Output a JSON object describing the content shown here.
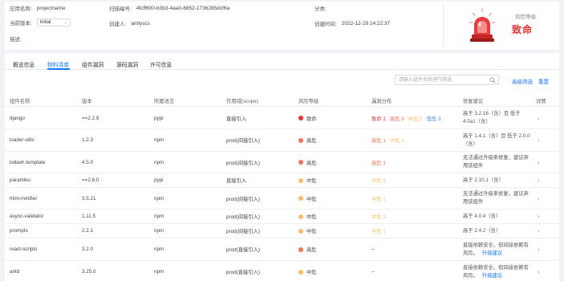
{
  "project": {
    "app_name_label": "应用名称:",
    "app_name": "projectname",
    "version_label": "当前版本:",
    "version": "initial",
    "desc_label": "描述:",
    "scan_id_label": "扫描编号:",
    "scan_id": "4fcff600-b3b3-4aa0-8852-1736285dcf6a",
    "creator_label": "创建人:",
    "creator": "antiyscs",
    "category_label": "分类:",
    "created_label": "创建时间:",
    "created": "2022-12-29 14:22:37",
    "risk_label": "风险等级",
    "risk_value": "致命"
  },
  "tabs": [
    "概览信息",
    "物料清单",
    "组件漏洞",
    "源码漏洞",
    "许可信息"
  ],
  "active_tab": 1,
  "toolbar": {
    "search_placeholder": "请输入组件名称进行筛选",
    "advanced_label": "高级筛选",
    "reset_label": "重置"
  },
  "table": {
    "headers": [
      "组件名称",
      "版本",
      "所属语言",
      "作用域(scope)",
      "风险等级",
      "漏洞分布",
      "修复建议",
      "详情"
    ],
    "rows": [
      {
        "name": "django",
        "version": "==2.2.9",
        "lang": "pypi",
        "scope": "直接引入",
        "risk": "致命",
        "risk_level": "critical",
        "dist": [
          {
            "text": "致命 1",
            "level": "critical"
          },
          {
            "text": "高危 9",
            "level": "high"
          },
          {
            "text": "中危 5",
            "level": "medium"
          },
          {
            "text": "低危 3",
            "level": "low"
          }
        ],
        "fix": "高于 3.2.16（含）且 低于 4.0a1（含）",
        "upgrade": ""
      },
      {
        "name": "loader-utils",
        "version": "1.2.3",
        "lang": "npm",
        "scope": "prod(间接引入)",
        "risk": "高危",
        "risk_level": "high",
        "dist": [
          {
            "text": "高危 1",
            "level": "high"
          },
          {
            "text": "中危 1",
            "level": "medium"
          }
        ],
        "fix": "高于 1.4.1（含）且 低于 2.0.0（含）",
        "upgrade": ""
      },
      {
        "name": "lodash.template",
        "version": "4.5.0",
        "lang": "npm",
        "scope": "prod(间接引入)",
        "risk": "高危",
        "risk_level": "high",
        "dist": [
          {
            "text": "高危 1",
            "level": "high"
          }
        ],
        "fix": "无法通过升级来修复，建议弃用该组件",
        "upgrade": ""
      },
      {
        "name": "paramiko",
        "version": "==2.6.0",
        "lang": "pypi",
        "scope": "直接引入",
        "risk": "中危",
        "risk_level": "medium",
        "dist": [
          {
            "text": "中危 1",
            "level": "medium"
          }
        ],
        "fix": "高于 2.10.1（含）",
        "upgrade": ""
      },
      {
        "name": "html-minifier",
        "version": "3.5.21",
        "lang": "npm",
        "scope": "prod(间接引入)",
        "risk": "中危",
        "risk_level": "medium",
        "dist": [
          {
            "text": "中危 1",
            "level": "medium"
          }
        ],
        "fix": "无法通过升级来修复，建议弃用该组件",
        "upgrade": ""
      },
      {
        "name": "async-validator",
        "version": "1.11.5",
        "lang": "npm",
        "scope": "prod(间接引入)",
        "risk": "中危",
        "risk_level": "medium",
        "dist": [
          {
            "text": "中危 1",
            "level": "medium"
          }
        ],
        "fix": "高于 4.0.4（含）",
        "upgrade": ""
      },
      {
        "name": "prompts",
        "version": "2.2.1",
        "lang": "npm",
        "scope": "prod(间接引入)",
        "risk": "中危",
        "risk_level": "medium",
        "dist": [
          {
            "text": "中危 1",
            "level": "medium"
          }
        ],
        "fix": "高于 2.4.2（含）",
        "upgrade": ""
      },
      {
        "name": "react-scripts",
        "version": "3.2.0",
        "lang": "npm",
        "scope": "prod(直接引入)",
        "risk": "高危",
        "risk_level": "high",
        "dist": [
          {
            "text": "–",
            "level": "none"
          }
        ],
        "fix": "直接依赖安全，但间接依赖有风险。",
        "upgrade": "升级建议"
      },
      {
        "name": "antd",
        "version": "3.25.0",
        "lang": "npm",
        "scope": "prod(直接引入)",
        "risk": "中危",
        "risk_level": "medium",
        "dist": [
          {
            "text": "–",
            "level": "none"
          }
        ],
        "fix": "直接依赖安全，但间接依赖有风险。",
        "upgrade": "升级建议"
      }
    ]
  },
  "colors": {
    "critical": "#e3342f",
    "high": "#f0735c",
    "medium": "#f7be6a",
    "low": "#3d8df5",
    "accent": "#1677ff"
  }
}
